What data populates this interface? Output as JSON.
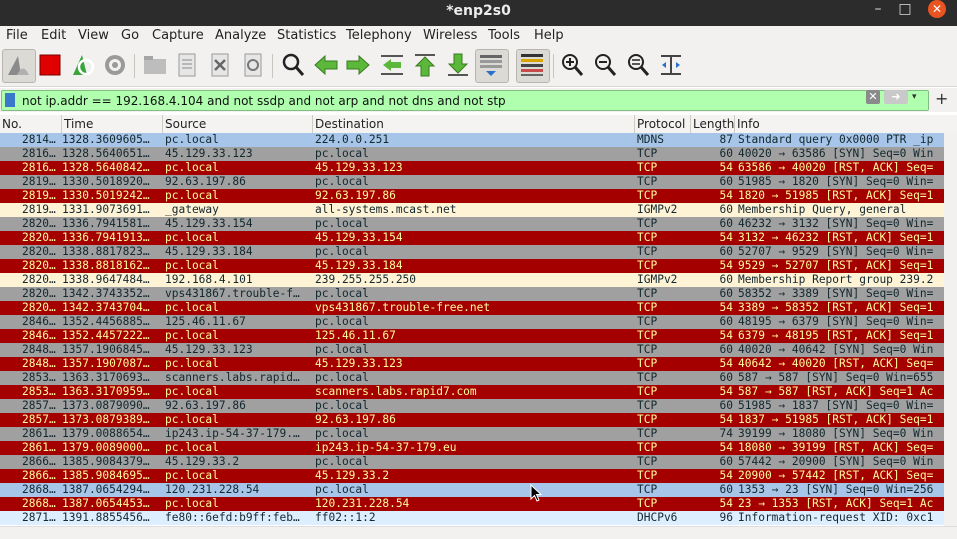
{
  "window": {
    "title": "*enp2s0",
    "minimize": "–",
    "maximize": "□",
    "close": "✕"
  },
  "menu": [
    "File",
    "Edit",
    "View",
    "Go",
    "Capture",
    "Analyze",
    "Statistics",
    "Telephony",
    "Wireless",
    "Tools",
    "Help"
  ],
  "filter": {
    "value": "not ip.addr == 192.168.4.104 and not ssdp and not arp and not dns and not stp",
    "clear": "✕",
    "apply": "➜",
    "dropdown": "▾",
    "add": "+"
  },
  "columns": [
    "No.",
    "Time",
    "Source",
    "Destination",
    "Protocol",
    "Length",
    "Info"
  ],
  "colors": {
    "blue": "#a6c5e8",
    "gray": "#a0a0a0",
    "red": "#a40000",
    "beige": "#fff3d6",
    "light": "#ddeeff"
  },
  "packets": [
    {
      "no": "2814…",
      "time": "1328.3609605…",
      "src": "pc.local",
      "dst": "224.0.0.251",
      "proto": "MDNS",
      "len": "87",
      "info": "Standard query 0x0000 PTR _ip",
      "style": "blue"
    },
    {
      "no": "2816…",
      "time": "1328.5640651…",
      "src": "45.129.33.123",
      "dst": "pc.local",
      "proto": "TCP",
      "len": "60",
      "info": "40020 → 63586 [SYN] Seq=0 Win",
      "style": "gray"
    },
    {
      "no": "2816…",
      "time": "1328.5640842…",
      "src": "pc.local",
      "dst": "45.129.33.123",
      "proto": "TCP",
      "len": "54",
      "info": "63586 → 40020 [RST, ACK] Seq=",
      "style": "red"
    },
    {
      "no": "2819…",
      "time": "1330.5018920…",
      "src": "92.63.197.86",
      "dst": "pc.local",
      "proto": "TCP",
      "len": "60",
      "info": "51985 → 1820 [SYN] Seq=0 Win=",
      "style": "gray"
    },
    {
      "no": "2819…",
      "time": "1330.5019242…",
      "src": "pc.local",
      "dst": "92.63.197.86",
      "proto": "TCP",
      "len": "54",
      "info": "1820 → 51985 [RST, ACK] Seq=1",
      "style": "red"
    },
    {
      "no": "2819…",
      "time": "1331.9073691…",
      "src": "_gateway",
      "dst": "all-systems.mcast.net",
      "proto": "IGMPv2",
      "len": "60",
      "info": "Membership Query, general",
      "style": "beige"
    },
    {
      "no": "2820…",
      "time": "1336.7941581…",
      "src": "45.129.33.154",
      "dst": "pc.local",
      "proto": "TCP",
      "len": "60",
      "info": "46232 → 3132 [SYN] Seq=0 Win=",
      "style": "gray"
    },
    {
      "no": "2820…",
      "time": "1336.7941913…",
      "src": "pc.local",
      "dst": "45.129.33.154",
      "proto": "TCP",
      "len": "54",
      "info": "3132 → 46232 [RST, ACK] Seq=1",
      "style": "red"
    },
    {
      "no": "2820…",
      "time": "1338.8817823…",
      "src": "45.129.33.184",
      "dst": "pc.local",
      "proto": "TCP",
      "len": "60",
      "info": "52707 → 9529 [SYN] Seq=0 Win=",
      "style": "gray"
    },
    {
      "no": "2820…",
      "time": "1338.8818162…",
      "src": "pc.local",
      "dst": "45.129.33.184",
      "proto": "TCP",
      "len": "54",
      "info": "9529 → 52707 [RST, ACK] Seq=1",
      "style": "red"
    },
    {
      "no": "2820…",
      "time": "1338.9647484…",
      "src": "192.168.4.101",
      "dst": "239.255.255.250",
      "proto": "IGMPv2",
      "len": "60",
      "info": "Membership Report group 239.2",
      "style": "beige"
    },
    {
      "no": "2820…",
      "time": "1342.3743352…",
      "src": "vps431867.trouble-f…",
      "dst": "pc.local",
      "proto": "TCP",
      "len": "60",
      "info": "58352 → 3389 [SYN] Seq=0 Win=",
      "style": "gray"
    },
    {
      "no": "2820…",
      "time": "1342.3743704…",
      "src": "pc.local",
      "dst": "vps431867.trouble-free.net",
      "proto": "TCP",
      "len": "54",
      "info": "3389 → 58352 [RST, ACK] Seq=1",
      "style": "red"
    },
    {
      "no": "2846…",
      "time": "1352.4456885…",
      "src": "125.46.11.67",
      "dst": "pc.local",
      "proto": "TCP",
      "len": "60",
      "info": "48195 → 6379 [SYN] Seq=0 Win=",
      "style": "gray"
    },
    {
      "no": "2846…",
      "time": "1352.4457222…",
      "src": "pc.local",
      "dst": "125.46.11.67",
      "proto": "TCP",
      "len": "54",
      "info": "6379 → 48195 [RST, ACK] Seq=1",
      "style": "red"
    },
    {
      "no": "2848…",
      "time": "1357.1906845…",
      "src": "45.129.33.123",
      "dst": "pc.local",
      "proto": "TCP",
      "len": "60",
      "info": "40020 → 40642 [SYN] Seq=0 Win",
      "style": "gray"
    },
    {
      "no": "2848…",
      "time": "1357.1907087…",
      "src": "pc.local",
      "dst": "45.129.33.123",
      "proto": "TCP",
      "len": "54",
      "info": "40642 → 40020 [RST, ACK] Seq=",
      "style": "red"
    },
    {
      "no": "2853…",
      "time": "1363.3170693…",
      "src": "scanners.labs.rapid…",
      "dst": "pc.local",
      "proto": "TCP",
      "len": "60",
      "info": "587 → 587 [SYN] Seq=0 Win=655",
      "style": "gray"
    },
    {
      "no": "2853…",
      "time": "1363.3170959…",
      "src": "pc.local",
      "dst": "scanners.labs.rapid7.com",
      "proto": "TCP",
      "len": "54",
      "info": "587 → 587 [RST, ACK] Seq=1 Ac",
      "style": "red"
    },
    {
      "no": "2857…",
      "time": "1373.0879090…",
      "src": "92.63.197.86",
      "dst": "pc.local",
      "proto": "TCP",
      "len": "60",
      "info": "51985 → 1837 [SYN] Seq=0 Win=",
      "style": "gray"
    },
    {
      "no": "2857…",
      "time": "1373.0879389…",
      "src": "pc.local",
      "dst": "92.63.197.86",
      "proto": "TCP",
      "len": "54",
      "info": "1837 → 51985 [RST, ACK] Seq=1",
      "style": "red"
    },
    {
      "no": "2861…",
      "time": "1379.0088654…",
      "src": "ip243.ip-54-37-179.…",
      "dst": "pc.local",
      "proto": "TCP",
      "len": "74",
      "info": "39199 → 18080 [SYN] Seq=0 Win",
      "style": "gray"
    },
    {
      "no": "2861…",
      "time": "1379.0089000…",
      "src": "pc.local",
      "dst": "ip243.ip-54-37-179.eu",
      "proto": "TCP",
      "len": "54",
      "info": "18080 → 39199 [RST, ACK] Seq=",
      "style": "red"
    },
    {
      "no": "2866…",
      "time": "1385.9084379…",
      "src": "45.129.33.2",
      "dst": "pc.local",
      "proto": "TCP",
      "len": "60",
      "info": "57442 → 20900 [SYN] Seq=0 Win",
      "style": "gray"
    },
    {
      "no": "2866…",
      "time": "1385.9084695…",
      "src": "pc.local",
      "dst": "45.129.33.2",
      "proto": "TCP",
      "len": "54",
      "info": "20900 → 57442 [RST, ACK] Seq=",
      "style": "red"
    },
    {
      "no": "2868…",
      "time": "1387.0654294…",
      "src": "120.231.228.54",
      "dst": "pc.local",
      "proto": "TCP",
      "len": "60",
      "info": "1353 → 23 [SYN] Seq=0 Win=256",
      "style": "blue"
    },
    {
      "no": "2868…",
      "time": "1387.0654453…",
      "src": "pc.local",
      "dst": "120.231.228.54",
      "proto": "TCP",
      "len": "54",
      "info": "23 → 1353 [RST, ACK] Seq=1 Ac",
      "style": "red"
    },
    {
      "no": "2871…",
      "time": "1391.8855456…",
      "src": "fe80::6efd:b9ff:feb…",
      "dst": "ff02::1:2",
      "proto": "DHCPv6",
      "len": "96",
      "info": "Information-request XID: 0xc1",
      "style": "light"
    }
  ]
}
